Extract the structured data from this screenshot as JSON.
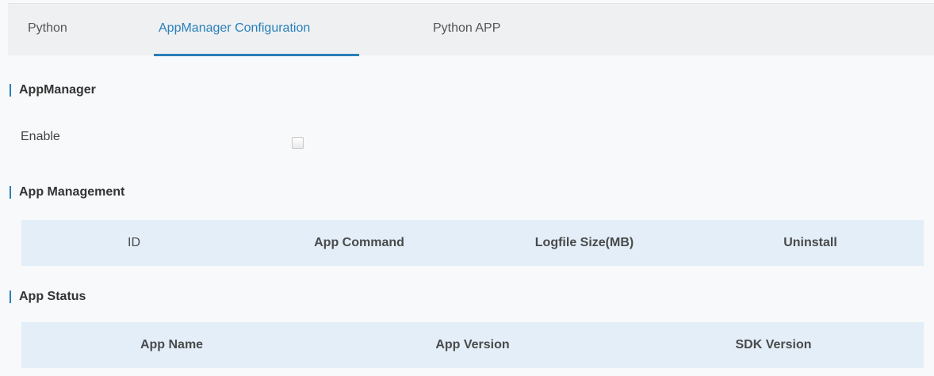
{
  "tabs": [
    {
      "label": "Python"
    },
    {
      "label": "AppManager Configuration"
    },
    {
      "label": "Python APP"
    }
  ],
  "active_tab_index": 1,
  "colors": {
    "accent": "#2a80b9",
    "tabbar_bg": "#eef0f2",
    "table_header_bg": "#e3eef8",
    "page_bg": "#f7f9fa"
  },
  "appmanager": {
    "title": "AppManager",
    "enable_label": "Enable",
    "enable_checked": false
  },
  "app_management": {
    "title": "App Management",
    "columns": [
      "ID",
      "App Command",
      "Logfile Size(MB)",
      "Uninstall"
    ]
  },
  "app_status": {
    "title": "App Status",
    "columns": [
      "App Name",
      "App Version",
      "SDK Version"
    ]
  }
}
